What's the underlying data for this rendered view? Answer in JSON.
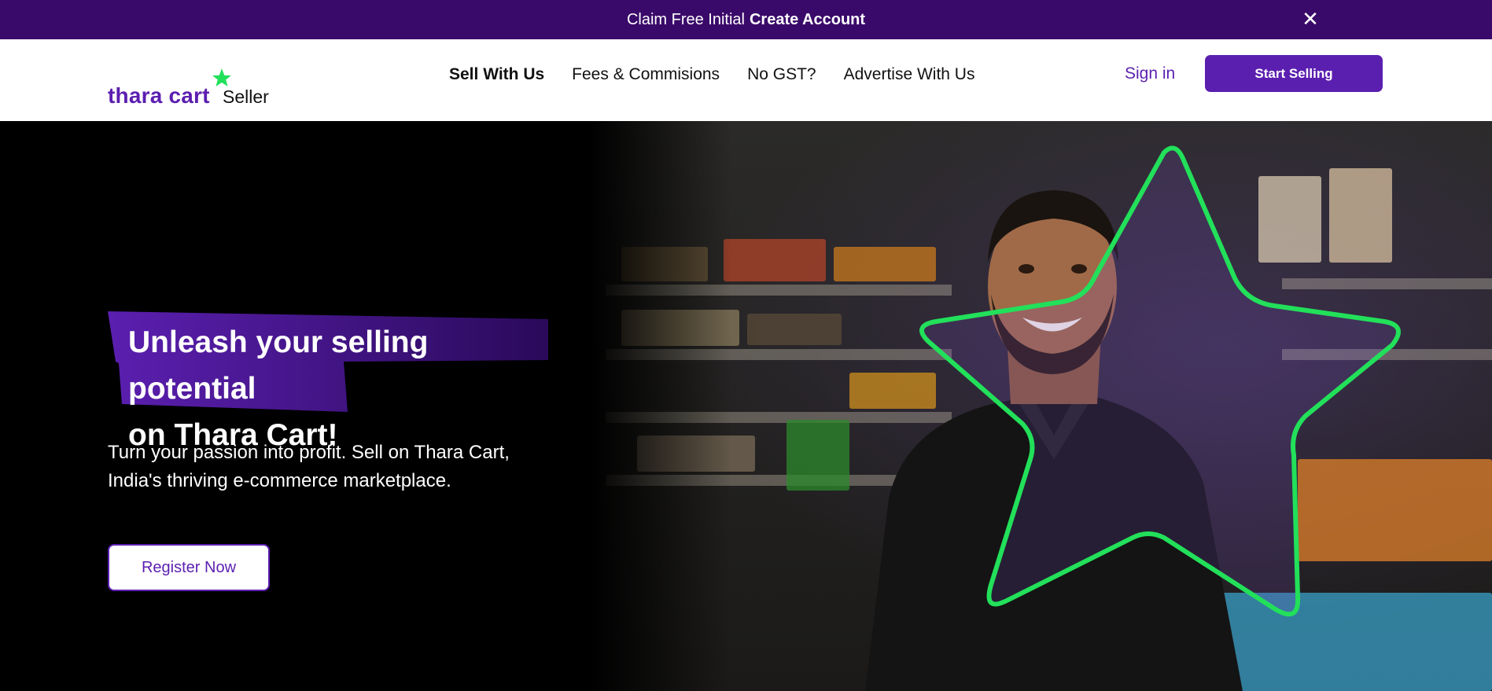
{
  "promo": {
    "text": "Claim Free Initial",
    "strong": "Create Account",
    "close_icon": "close-icon"
  },
  "header": {
    "logo": {
      "brand": "thara cart",
      "suffix": "Seller",
      "icon": "star-icon"
    },
    "nav": [
      {
        "label": "Sell With Us",
        "active": true
      },
      {
        "label": "Fees & Commisions",
        "active": false
      },
      {
        "label": "No GST?",
        "active": false
      },
      {
        "label": "Advertise With Us",
        "active": false
      }
    ],
    "signin_label": "Sign in",
    "start_selling_label": "Start Selling"
  },
  "hero": {
    "headline_line1": "Unleash your selling potential",
    "headline_line2": "on Thara Cart!",
    "subtext_line1": "Turn your passion into profit. Sell on Thara Cart,",
    "subtext_line2": "India's thriving e-commerce marketplace.",
    "register_label": "Register Now",
    "image": "smiling-seller-in-store-photo"
  },
  "colors": {
    "brand_purple": "#5b1fb0",
    "banner_purple": "#3a0a6a",
    "accent_green": "#22e05a"
  }
}
